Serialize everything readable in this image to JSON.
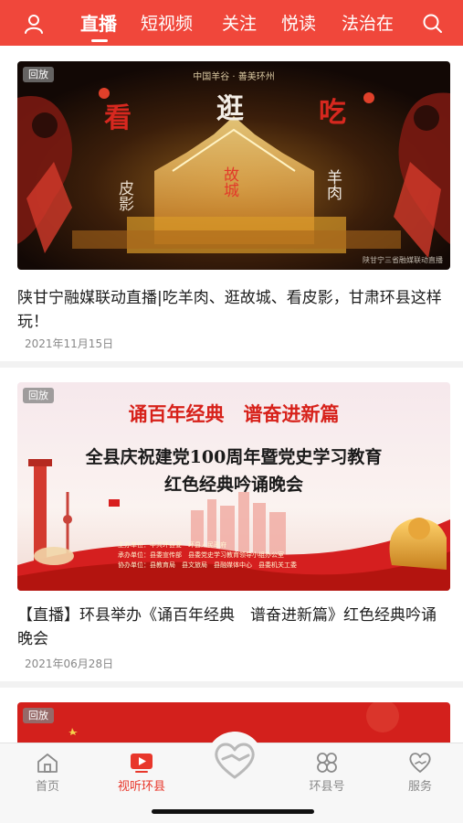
{
  "top_nav": {
    "tabs": [
      {
        "label": "直播",
        "active": true
      },
      {
        "label": "短视频",
        "active": false
      },
      {
        "label": "关注",
        "active": false
      },
      {
        "label": "悦读",
        "active": false
      },
      {
        "label": "法治在",
        "active": false
      }
    ],
    "icons": {
      "left": "user-icon",
      "right": "search-icon"
    },
    "accent_color": "#f0473b"
  },
  "feed": [
    {
      "badge": "回放",
      "image_text": {
        "header": "中国羊谷 · 善美环州",
        "chars": [
          "看",
          "逛",
          "吃"
        ],
        "col_left": "皮影",
        "col_mid": "故城",
        "col_right": "羊肉",
        "footer": "陕甘宁三省融媒联动直播"
      },
      "title": "陕甘宁融媒联动直播|吃羊肉、逛故城、看皮影，甘肃环县这样玩！",
      "date": "2021年11月15日"
    },
    {
      "badge": "回放",
      "image_text": {
        "line1": "诵百年经典　谱奋进新篇",
        "line2": "全县庆祝建党100周年暨党史学习教育",
        "line3": "红色经典吟诵晚会",
        "sponsors": [
          "主办单位：中共环县委　环县人民政府",
          "承办单位：县委宣传部　县委党史学习教育领导小组办公室",
          "协办单位：县教育局　县文旅局　县融媒体中心　县委机关工委"
        ]
      },
      "title": "【直播】环县举办《诵百年经典　谱奋进新篇》红色经典吟诵晚会",
      "date": "2021年06月28日"
    },
    {
      "badge": "回放"
    }
  ],
  "bottom_nav": {
    "items": [
      {
        "label": "首页",
        "icon": "home-icon",
        "active": false
      },
      {
        "label": "视听环县",
        "icon": "play-tv-icon",
        "active": true
      },
      {
        "label": "",
        "icon": "heart-hand-icon",
        "active": false
      },
      {
        "label": "环县号",
        "icon": "grid-icon",
        "active": false
      },
      {
        "label": "服务",
        "icon": "heart-outline-icon",
        "active": false
      }
    ],
    "active_color": "#e8372b"
  }
}
